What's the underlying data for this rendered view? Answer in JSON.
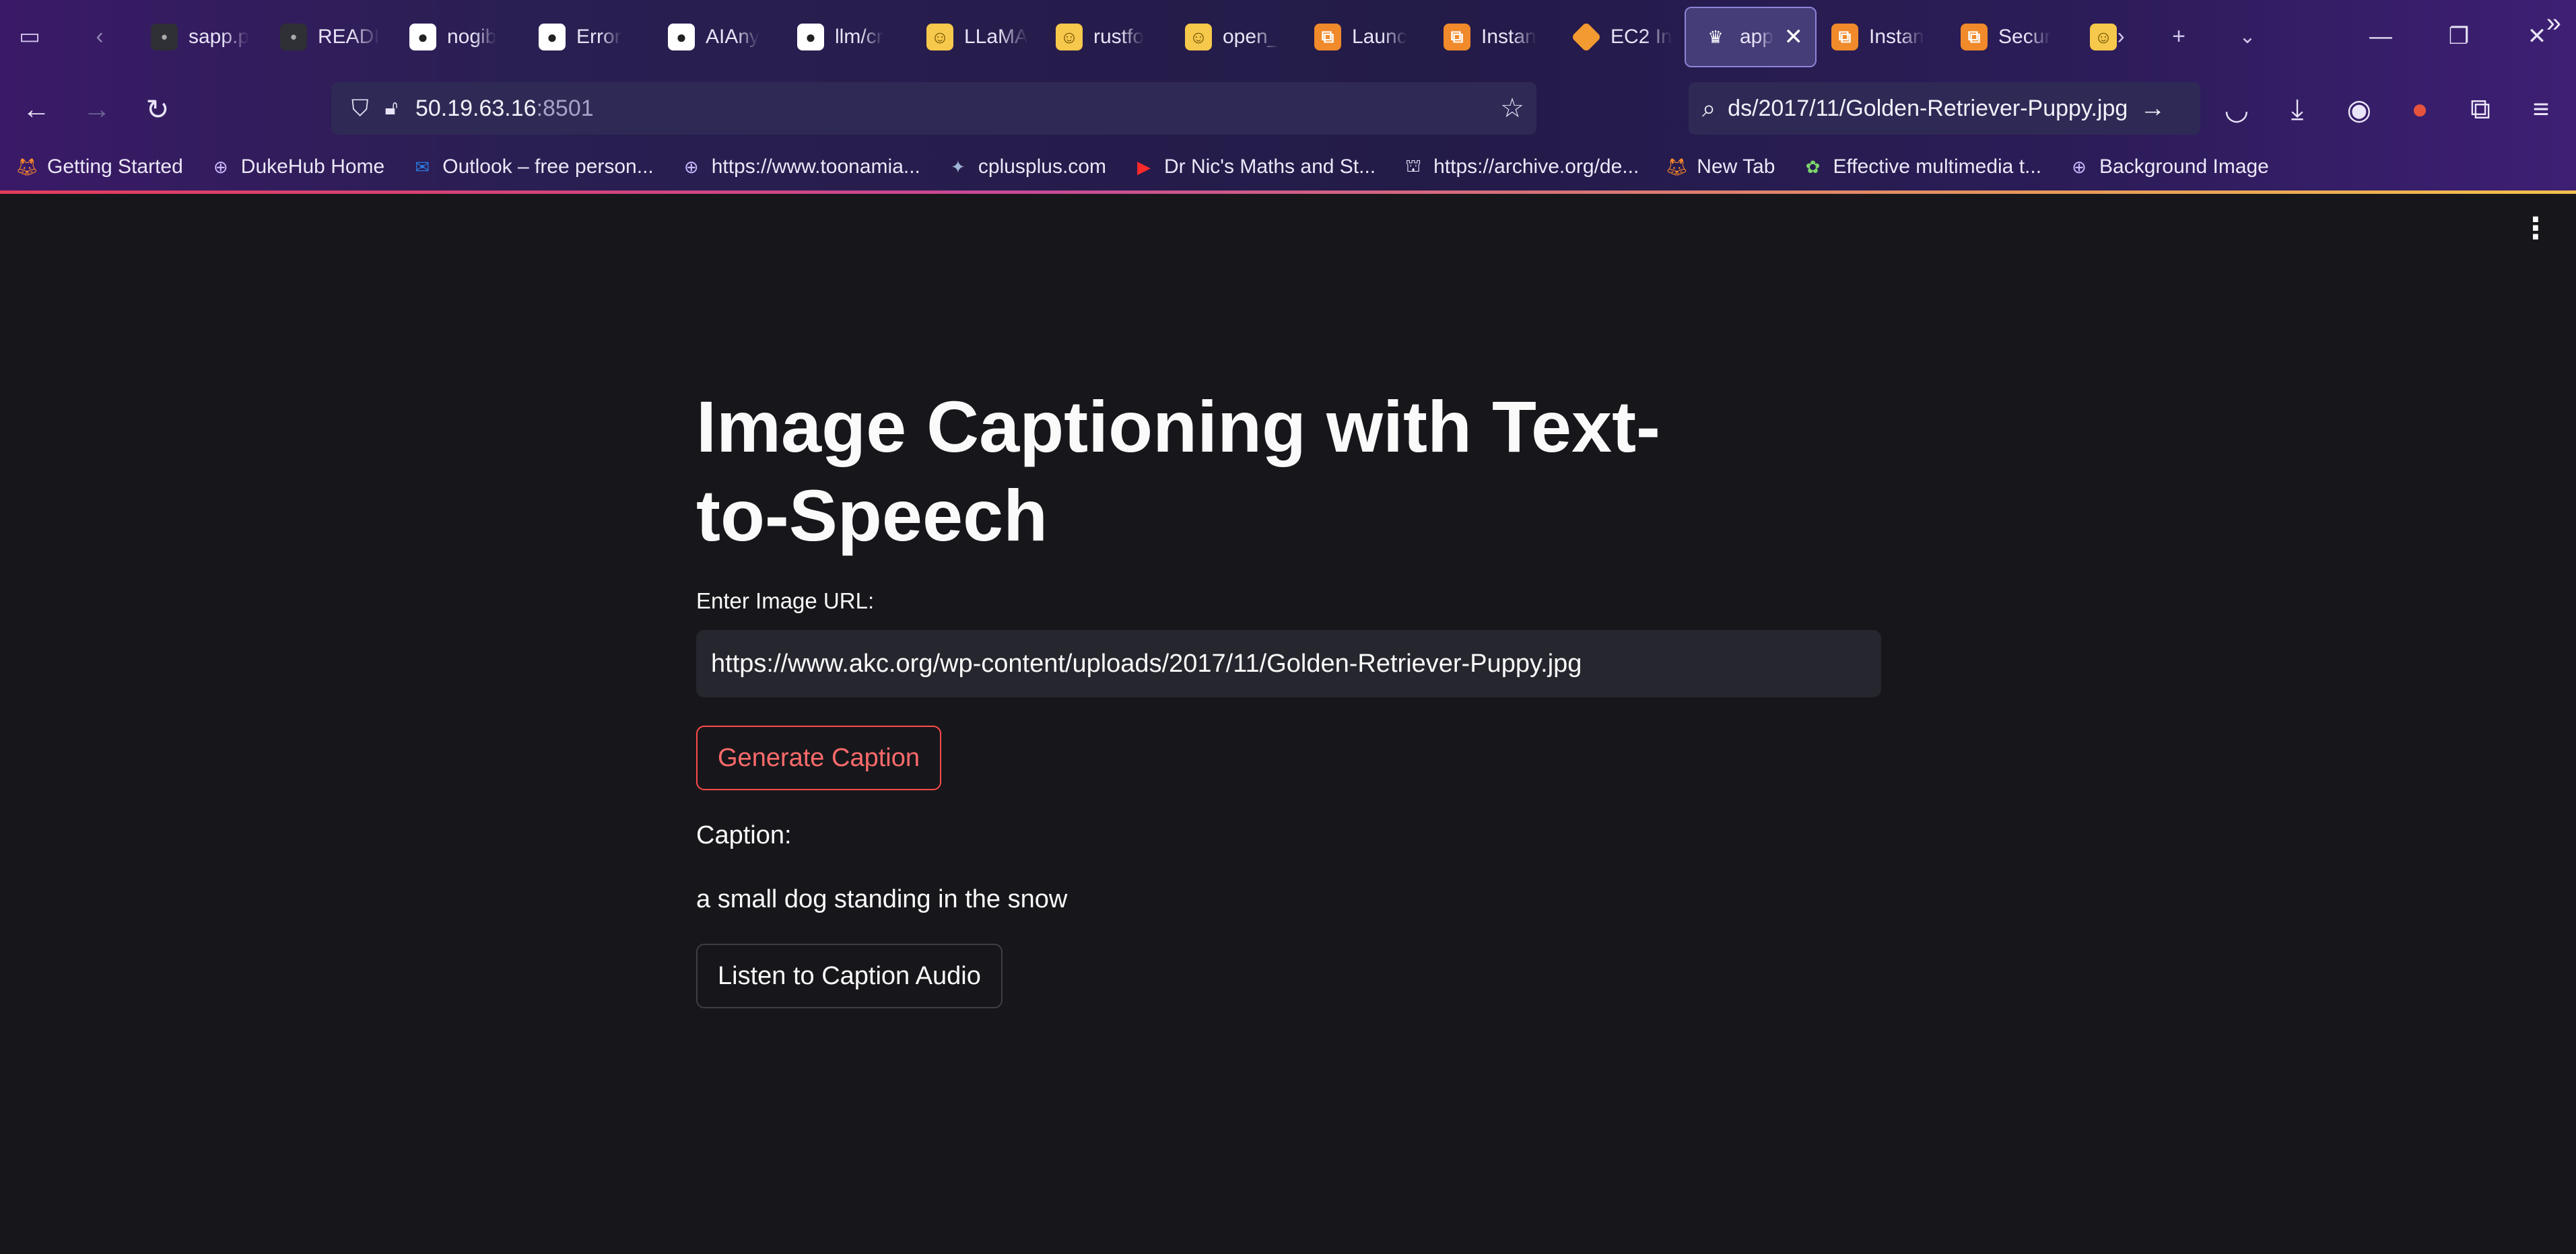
{
  "browser": {
    "tabs": [
      {
        "label": "sapp.p",
        "icon": "dark-favicon",
        "active": false
      },
      {
        "label": "READI",
        "icon": "dark-favicon",
        "active": false
      },
      {
        "label": "nogib",
        "icon": "github-icon",
        "active": false
      },
      {
        "label": "Error",
        "icon": "github-icon",
        "active": false
      },
      {
        "label": "AIAny",
        "icon": "github-icon",
        "active": false
      },
      {
        "label": "llm/cr",
        "icon": "github-icon",
        "active": false
      },
      {
        "label": "LLaMA",
        "icon": "huggingface-icon",
        "active": false
      },
      {
        "label": "rustfo",
        "icon": "huggingface-icon",
        "active": false
      },
      {
        "label": "open_",
        "icon": "huggingface-icon",
        "active": false
      },
      {
        "label": "Launc",
        "icon": "aws-icon",
        "active": false
      },
      {
        "label": "Instan",
        "icon": "aws-icon",
        "active": false
      },
      {
        "label": "EC2 In",
        "icon": "ec2-icon",
        "active": false
      },
      {
        "label": "app",
        "icon": "streamlit-icon",
        "active": true
      },
      {
        "label": "Instan",
        "icon": "aws-icon",
        "active": false
      },
      {
        "label": "Secur",
        "icon": "aws-icon",
        "active": false
      },
      {
        "label": "",
        "icon": "huggingface-icon",
        "active": false
      }
    ],
    "url": {
      "host": "50.19.63.16",
      "port": ":8501"
    },
    "search_text": "ds/2017/11/Golden-Retriever-Puppy.jpg",
    "bookmarks": [
      {
        "label": "Getting Started",
        "icon": "firefox-icon"
      },
      {
        "label": "DukeHub Home",
        "icon": "globe-icon"
      },
      {
        "label": "Outlook – free person...",
        "icon": "outlook-icon"
      },
      {
        "label": "https://www.toonamia...",
        "icon": "globe-icon"
      },
      {
        "label": "cplusplus.com",
        "icon": "cplusplus-icon"
      },
      {
        "label": "Dr Nic's Maths and St...",
        "icon": "youtube-icon"
      },
      {
        "label": "https://archive.org/de...",
        "icon": "archive-icon"
      },
      {
        "label": "New Tab",
        "icon": "firefox-icon"
      },
      {
        "label": "Effective multimedia t...",
        "icon": "colorful-icon"
      },
      {
        "label": "Background Image",
        "icon": "globe-icon"
      }
    ]
  },
  "app": {
    "title": "Image Captioning with Text-to-Speech",
    "url_label": "Enter Image URL:",
    "url_value": "https://www.akc.org/wp-content/uploads/2017/11/Golden-Retriever-Puppy.jpg",
    "generate_button": "Generate Caption",
    "caption_label": "Caption:",
    "caption_text": "a small dog standing in the snow",
    "listen_button": "Listen to Caption Audio"
  },
  "colors": {
    "background": "#17171b",
    "accent": "#ff4b4b",
    "chrome": "#2a1f52"
  }
}
